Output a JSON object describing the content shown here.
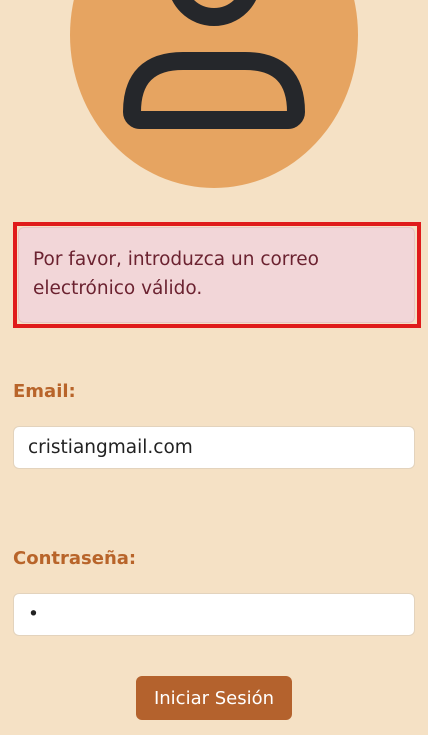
{
  "avatar": {
    "icon": "user-icon"
  },
  "alert": {
    "message": "Por favor, introduzca un correo electrónico válido."
  },
  "form": {
    "email_label": "Email:",
    "email_value": "cristiangmail.com",
    "password_label": "Contraseña:",
    "password_value": "a",
    "submit_label": "Iniciar Sesión"
  },
  "colors": {
    "background": "#f5e1c5",
    "avatar_fill": "#e6a461",
    "icon_stroke": "#25272b",
    "alert_background": "#f2d6d8",
    "alert_text": "#6b2230",
    "highlight": "#e01b1b",
    "label": "#b8642a",
    "button": "#b4622d"
  }
}
